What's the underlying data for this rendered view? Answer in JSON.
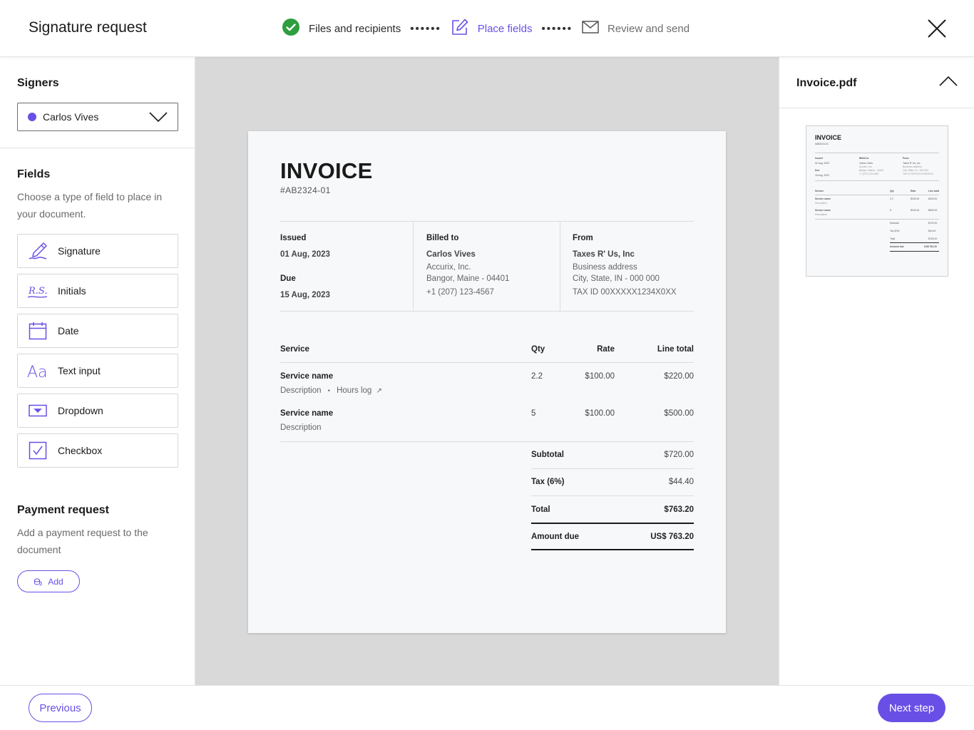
{
  "header": {
    "title": "Signature request",
    "steps": [
      {
        "label": "Files and recipients",
        "state": "done",
        "icon": "check-circle-icon"
      },
      {
        "label": "Place fields",
        "state": "active",
        "icon": "edit-icon"
      },
      {
        "label": "Review and send",
        "state": "pending",
        "icon": "envelope-icon"
      }
    ],
    "step_separator": "••••••"
  },
  "colors": {
    "accent": "#6a4fe6",
    "success": "#2e9e3e"
  },
  "sidebar": {
    "signers_title": "Signers",
    "selected_signer": "Carlos Vives",
    "fields_title": "Fields",
    "fields_description": "Choose a type of field to place in your document.",
    "fields": [
      {
        "label": "Signature",
        "icon": "signature-pen-icon"
      },
      {
        "label": "Initials",
        "icon": "initials-icon"
      },
      {
        "label": "Date",
        "icon": "calendar-icon"
      },
      {
        "label": "Text input",
        "icon": "text-input-icon"
      },
      {
        "label": "Dropdown",
        "icon": "dropdown-icon"
      },
      {
        "label": "Checkbox",
        "icon": "checkbox-icon"
      }
    ],
    "initials_glyph": "R.S.",
    "text_glyph": "Aa",
    "payment_title": "Payment request",
    "payment_description": "Add a payment request to the document",
    "add_label": "Add"
  },
  "invoice": {
    "title": "INVOICE",
    "number": "#AB2324-01",
    "issued_label": "Issued",
    "issued_date": "01 Aug, 2023",
    "due_label": "Due",
    "due_date": "15 Aug, 2023",
    "billed_to_label": "Billed to",
    "billed_to": {
      "name": "Carlos Vives",
      "company": "Accurix, Inc.",
      "address": "Bangor, Maine - 04401",
      "phone": "+1 (207) 123-4567"
    },
    "from_label": "From",
    "from": {
      "name": "Taxes R' Us, Inc",
      "address1": "Business address",
      "address2": "City, State, IN - 000 000",
      "tax_id": "TAX ID 00XXXXX1234X0XX"
    },
    "columns": {
      "service": "Service",
      "qty": "Qty",
      "rate": "Rate",
      "line_total": "Line total"
    },
    "items": [
      {
        "name": "Service name",
        "description": "Description",
        "extra": "Hours log",
        "qty": "2.2",
        "rate": "$100.00",
        "total": "$220.00"
      },
      {
        "name": "Service name",
        "description": "Description",
        "qty": "5",
        "rate": "$100.00",
        "total": "$500.00"
      }
    ],
    "subtotal_label": "Subtotal",
    "subtotal": "$720.00",
    "tax_label": "Tax (6%)",
    "tax": "$44.40",
    "total_label": "Total",
    "total": "$763.20",
    "amount_due_label": "Amount due",
    "amount_due": "US$ 763.20"
  },
  "preview": {
    "file_name": "Invoice.pdf"
  },
  "footer": {
    "previous_label": "Previous",
    "next_label": "Next step"
  }
}
